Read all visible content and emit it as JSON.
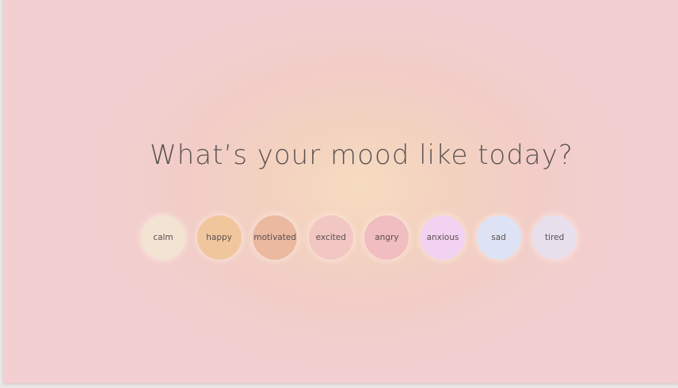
{
  "prompt": {
    "title": "What’s your mood like today?"
  },
  "moods": [
    {
      "label": "calm",
      "color": "#f3e3d3"
    },
    {
      "label": "happy",
      "color": "#f0c79d"
    },
    {
      "label": "motivated",
      "color": "#ebb8a0"
    },
    {
      "label": "excited",
      "color": "#f2c7c3"
    },
    {
      "label": "angry",
      "color": "#f0bdc0"
    },
    {
      "label": "anxious",
      "color": "#f1d2f1"
    },
    {
      "label": "sad",
      "color": "#dde3f4"
    },
    {
      "label": "tired",
      "color": "#e8dfed"
    }
  ]
}
